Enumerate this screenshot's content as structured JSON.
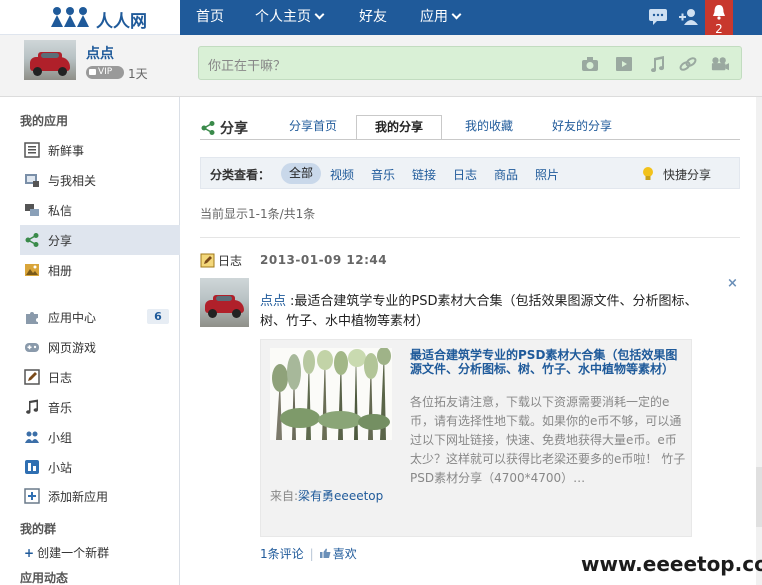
{
  "brand": {
    "name": "人人网"
  },
  "nav": {
    "items": [
      {
        "label": "首页"
      },
      {
        "label": "个人主页"
      },
      {
        "label": "好友"
      },
      {
        "label": "应用"
      }
    ],
    "notification_count": "2"
  },
  "profile": {
    "name": "点点",
    "vip_label": "VIP",
    "vip_days": "1天",
    "status_placeholder": "你正在干嘛？"
  },
  "sidebar": {
    "section_my_apps": "我的应用",
    "items": [
      {
        "label": "新鲜事",
        "icon": "news-icon"
      },
      {
        "label": "与我相关",
        "icon": "related-icon"
      },
      {
        "label": "私信",
        "icon": "message-icon"
      },
      {
        "label": "分享",
        "icon": "share-icon"
      },
      {
        "label": "相册",
        "icon": "album-icon"
      }
    ],
    "apps": [
      {
        "label": "应用中心",
        "icon": "puzzle-icon",
        "badge": "6"
      },
      {
        "label": "网页游戏",
        "icon": "gamepad-icon"
      },
      {
        "label": "日志",
        "icon": "blog-icon"
      },
      {
        "label": "音乐",
        "icon": "music-icon"
      },
      {
        "label": "小组",
        "icon": "group-icon"
      },
      {
        "label": "小站",
        "icon": "site-icon"
      }
    ],
    "add_app": "添加新应用",
    "section_my_groups": "我的群",
    "create_group": "创建一个新群",
    "section_app_feed": "应用动态"
  },
  "share": {
    "heading": "分享",
    "tabs": [
      "分享首页",
      "我的分享",
      "我的收藏",
      "好友的分享"
    ],
    "filter_label": "分类查看：",
    "filters": [
      "全部",
      "视频",
      "音乐",
      "链接",
      "日志",
      "商品",
      "照片"
    ],
    "quick_share": "快捷分享",
    "count_text": "当前显示1-1条/共1条"
  },
  "post": {
    "type": "日志",
    "time": "2013-01-09 12:44",
    "author": "点点",
    "text": ":最适合建筑学专业的PSD素材大合集（包括效果图源文件、分析图标、树、竹子、水中植物等素材）",
    "card_title": "最适合建筑学专业的PSD素材大合集（包括效果图源文件、分析图标、树、竹子、水中植物等素材）",
    "card_desc": "各位拓友请注意，下载以下资源需要消耗一定的e币，请有选择性地下载。如果你的e币不够，可以通过以下网址链接，快速、免费地获得大量e币。e币太少？这样就可以获得比老梁还要多的e币啦！ 竹子PSD素材分享（4700*4700）…",
    "source_label": "来自:",
    "source_name": "梁有勇eeeetop",
    "comments": "1条评论",
    "like": "喜欢"
  },
  "watermark": "www.eeeetop.com",
  "colors": {
    "nav_bg": "#1f5a9a",
    "link": "#1f5a9a",
    "status_bg": "#d9f0d6",
    "notify": "#c8382d"
  }
}
